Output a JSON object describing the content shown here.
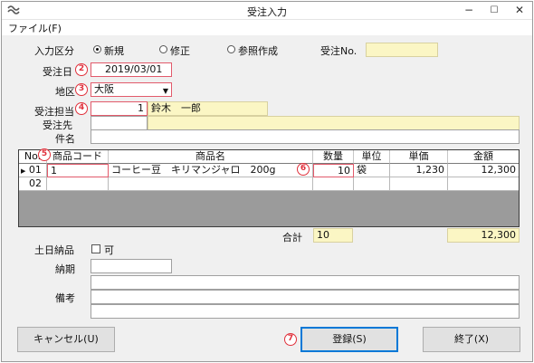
{
  "window": {
    "title": "受注入力"
  },
  "titlebar": {
    "minimize": "−",
    "maximize": "☐",
    "close": "✕"
  },
  "menu": {
    "file": "ファイル(F)"
  },
  "form": {
    "order_type_label": "入力区分",
    "order_type_options": [
      "新規",
      "修正",
      "参照作成"
    ],
    "order_type_selected": "新規",
    "order_no_label": "受注No.",
    "order_no_value": "",
    "order_date_label": "受注日",
    "order_date_value": "2019/03/01",
    "region_label": "地区",
    "region_value": "大阪",
    "staff_label": "受注担当",
    "staff_code": "1",
    "staff_name": "鈴木　一郎",
    "customer_label": "受注先",
    "customer_code": "",
    "customer_name": "",
    "subject_label": "件名",
    "subject_value": ""
  },
  "grid": {
    "headers": {
      "no": "No.",
      "code": "商品コード",
      "name": "商品名",
      "qty": "数量",
      "unit": "単位",
      "price": "単価",
      "amount": "金額"
    },
    "rows": [
      {
        "no": "01",
        "code": "1",
        "name": "コーヒー豆　キリマンジャロ　200g",
        "qty": "10",
        "unit": "袋",
        "price": "1,230",
        "amount": "12,300",
        "current": true
      },
      {
        "no": "02",
        "code": "",
        "name": "",
        "qty": "",
        "unit": "",
        "price": "",
        "amount": "",
        "current": false
      }
    ],
    "current_row_marker": "▶"
  },
  "totals": {
    "label": "合計",
    "qty": "10",
    "amount": "12,300"
  },
  "weekend": {
    "label": "土日納品",
    "checkbox_label": "可",
    "checked": false
  },
  "delivery": {
    "label": "納期",
    "value": ""
  },
  "remarks": {
    "label": "備考",
    "lines": [
      "",
      "",
      ""
    ]
  },
  "buttons": {
    "cancel": "キャンセル(U)",
    "register": "登録(S)",
    "exit": "終了(X)"
  },
  "annotations": {
    "b2": "2",
    "b3": "3",
    "b4": "4",
    "b5": "5",
    "b6": "6",
    "b7": "7"
  },
  "colors": {
    "readonly_bg": "#fbf6c4",
    "badge": "#e0303b",
    "grid_bg": "#9b9b9b",
    "focus": "#0078d7"
  }
}
